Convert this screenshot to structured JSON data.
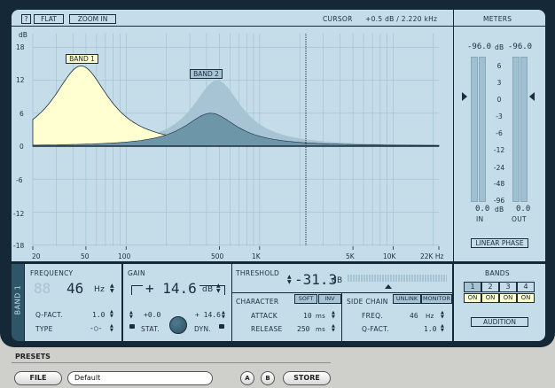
{
  "toolbar": {
    "help": "?",
    "flat": "FLAT",
    "zoom_in": "ZOOM IN",
    "cursor_label": "CURSOR",
    "cursor_value": "+0.5 dB /  2.220 kHz"
  },
  "graph": {
    "db_unit": "dB",
    "y_ticks": [
      "18",
      "12",
      "6",
      "0",
      "-6",
      "-12",
      "-18"
    ],
    "x_ticks": [
      "20",
      "50",
      "100",
      "500",
      "1K",
      "5K",
      "10K",
      "22K Hz"
    ],
    "band1_tag": "BAND 1",
    "band2_tag": "BAND 2",
    "bands": [
      {
        "freq_hz": 46,
        "gain_db": 14.6
      },
      {
        "freq_hz": 430,
        "gain_db": 6.0
      }
    ],
    "cursor_khz": 2.22
  },
  "meters": {
    "title": "METERS",
    "left_peak": "-96.0",
    "unit": "dB",
    "right_peak": "-96.0",
    "scale": [
      "6",
      "3",
      "0",
      "-3",
      "-6",
      "-12",
      "-24",
      "-48",
      "-96"
    ],
    "in_value": "0.0",
    "out_value": "0.0",
    "in_label": "IN",
    "out_label": "OUT",
    "linear_phase": "LINEAR PHASE"
  },
  "band_strip": {
    "label": "BAND 1"
  },
  "frequency": {
    "title": "FREQUENCY",
    "value": "46",
    "unit": "Hz",
    "q_label": "Q-FACT.",
    "q_value": "1.0",
    "type_label": "TYPE",
    "type_value": "-○-"
  },
  "gain": {
    "title": "GAIN",
    "value": "+ 14.6",
    "unit": "dB",
    "stat_value": "+0.0",
    "dyn_value": "+ 14.6",
    "stat_label": "STAT.",
    "dyn_label": "DYN."
  },
  "threshold": {
    "title": "THRESHOLD",
    "value": "-31.3",
    "unit": "dB"
  },
  "character": {
    "title": "CHARACTER",
    "soft": "SOFT",
    "inv": "INV",
    "attack_label": "ATTACK",
    "attack_value": "10",
    "attack_unit": "ms",
    "release_label": "RELEASE",
    "release_value": "250",
    "release_unit": "ms"
  },
  "sidechain": {
    "title": "SIDE CHAIN",
    "unlink": "UNLINK",
    "monitor": "MONITOR",
    "freq_label": "FREQ.",
    "freq_value": "46",
    "freq_unit": "Hz",
    "q_label": "Q-FACT.",
    "q_value": "1.0"
  },
  "bands_panel": {
    "title": "BANDS",
    "numbers": [
      "1",
      "2",
      "3",
      "4"
    ],
    "on": [
      "ON",
      "ON",
      "ON",
      "ON"
    ],
    "audition": "AUDITION"
  },
  "presets": {
    "title": "PRESETS",
    "file": "FILE",
    "name": "Default",
    "a": "A",
    "b": "B",
    "store": "STORE"
  }
}
